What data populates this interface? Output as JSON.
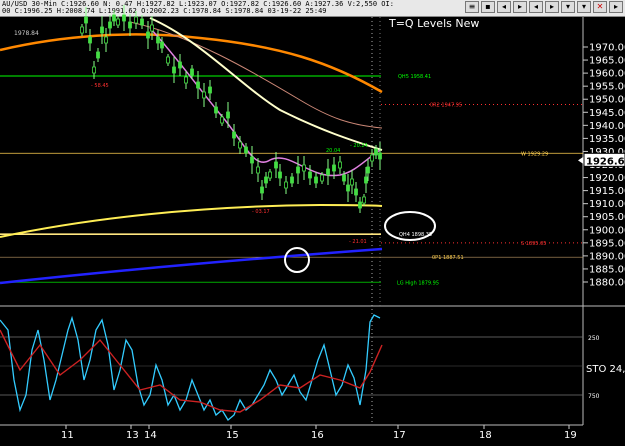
{
  "header": {
    "line1": "AU/USD 30-Min  C:1926.60  N:  0.47  H:1927.82  L:1923.07  O:1927.82  C:1926.60  A:1927.36  V:2,550  OI:",
    "line2": "00  C:1996.25  H:2008.74  L:1991.62  O:2002.23  C:1978.84  S:1978.84  03-19-22  25:49",
    "buttons": [
      "≡",
      "▪",
      "◂",
      "▸",
      "◂",
      "▸",
      "▾",
      "▾",
      "✕",
      "▸"
    ],
    "icons": [
      "menu-icon",
      "stop-icon",
      "scroll-left-icon",
      "scroll-right-icon",
      "zoom-out-icon",
      "zoom-in-icon",
      "dropdown-icon",
      "dropdown-icon",
      "close-icon",
      "play-icon"
    ]
  },
  "chart": {
    "title": "T=Q Levels New",
    "top_label": "1978.84",
    "price_ticks": [
      "1970.00",
      "1965.00",
      "1960.00",
      "1955.00",
      "1950.00",
      "1945.00",
      "1940.00",
      "1935.00",
      "1930.00",
      "1925.00",
      "1920.00",
      "1915.00",
      "1910.00",
      "1905.00",
      "1900.00",
      "1895.00",
      "1890.00",
      "1885.00",
      "1880.00"
    ],
    "last_price": "1926.60",
    "date_labels": [
      "11",
      "13",
      "14",
      "15",
      "16",
      "17",
      "18",
      "19"
    ],
    "levels": [
      {
        "label": "QH5  1958.41",
        "color": "#00ff00"
      },
      {
        "label": "0R2  1947.95",
        "color": "#ff3030"
      },
      {
        "label": "W  1929.29",
        "color": "#ffd050"
      },
      {
        "label": "QH4  1898.35",
        "color": "#ffffff"
      },
      {
        "label": "S  1895.05",
        "color": "#ff3030"
      },
      {
        "label": "0P1  1887.51",
        "color": "#ffd050"
      },
      {
        "label": "LG High  1879.95",
        "color": "#00ff00"
      }
    ],
    "annotations": [
      {
        "text": "- 58.45",
        "color": "#ff3030"
      },
      {
        "text": "20.04",
        "color": "#00ff00"
      },
      {
        "text": "- 20.24",
        "color": "#00ff00"
      },
      {
        "text": "- 03.17",
        "color": "#ff3030"
      },
      {
        "text": "- 21.01",
        "color": "#ff3030"
      }
    ]
  },
  "oscillator": {
    "label": "STO  24,",
    "ticks": [
      "250",
      "750"
    ]
  }
}
